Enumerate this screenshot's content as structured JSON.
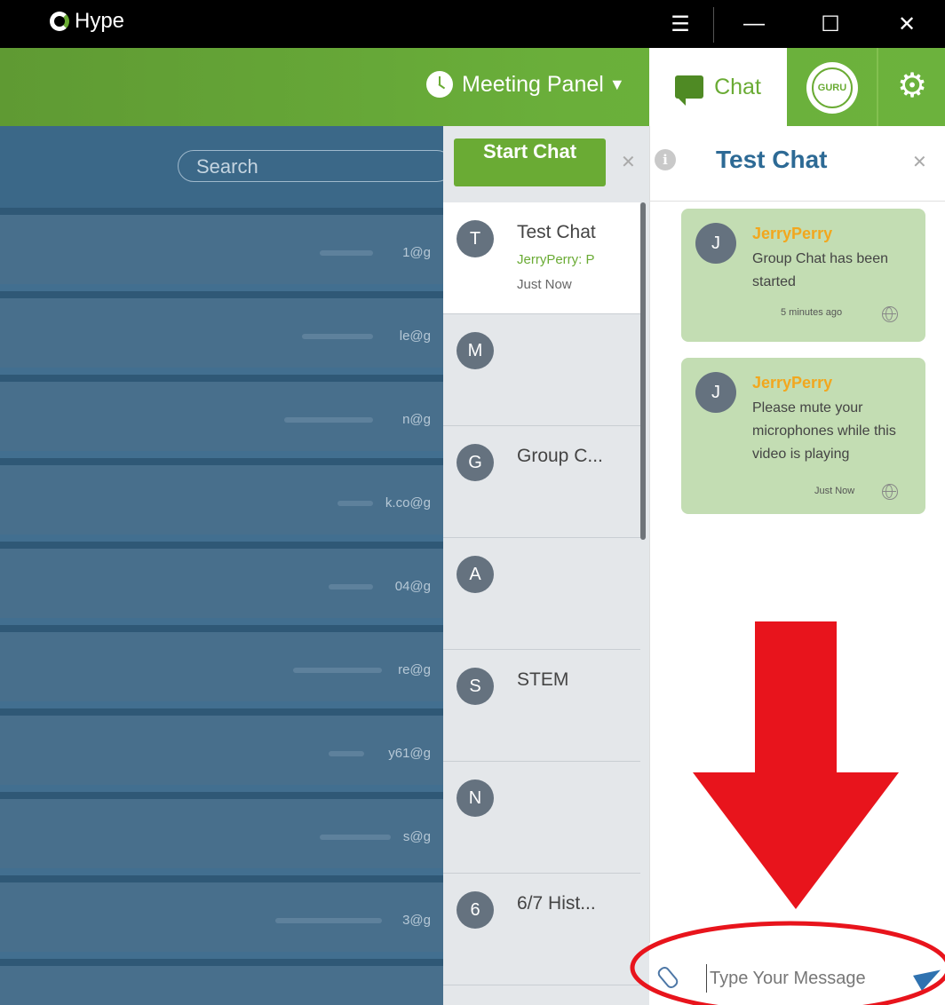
{
  "titlebar": {
    "app_name": "Hype",
    "menu_glyph": "☰",
    "minimize_glyph": "—",
    "maximize_glyph": "☐",
    "close_glyph": "✕"
  },
  "header": {
    "meeting_panel_label": "Meeting Panel",
    "meeting_panel_caret": "▼",
    "chat_tab_label": "Chat",
    "guru_label": "GURU",
    "settings_glyph": "⚙"
  },
  "contacts": {
    "search_placeholder": "Search",
    "rows": [
      {
        "email": "1@g"
      },
      {
        "email": "le@g"
      },
      {
        "email": "n@g"
      },
      {
        "email": "k.co@g"
      },
      {
        "email": "04@g"
      },
      {
        "email": "re@g"
      },
      {
        "email": "y61@g"
      },
      {
        "email": "s@g"
      },
      {
        "email": "3@g"
      },
      {
        "email": ""
      }
    ]
  },
  "chatlist": {
    "start_chat_label": "Start Chat",
    "close_glyph": "✕",
    "items": [
      {
        "initial": "T",
        "title": "Test Chat",
        "preview": "JerryPerry: P",
        "time": "Just Now",
        "active": true
      },
      {
        "initial": "M",
        "title": "",
        "preview": "",
        "time": ""
      },
      {
        "initial": "G",
        "title": "Group C...",
        "preview": "",
        "time": ""
      },
      {
        "initial": "A",
        "title": "",
        "preview": "",
        "time": ""
      },
      {
        "initial": "S",
        "title": "STEM",
        "preview": "",
        "time": ""
      },
      {
        "initial": "N",
        "title": "",
        "preview": "",
        "time": ""
      },
      {
        "initial": "6",
        "title": "6/7 Hist...",
        "preview": "",
        "time": ""
      }
    ]
  },
  "conversation": {
    "info_glyph": "i",
    "title": "Test Chat",
    "close_glyph": "✕",
    "messages": [
      {
        "initial": "J",
        "sender": "JerryPerry",
        "text": "Group Chat has been started",
        "time": "5 minutes ago"
      },
      {
        "initial": "J",
        "sender": "JerryPerry",
        "text": "Please mute your microphones while this video is playing",
        "time": "Just Now"
      }
    ],
    "input_placeholder": "Type Your Message"
  },
  "colors": {
    "brand_green": "#6aab34",
    "panel_blue": "#426f90",
    "title_blue": "#2d6a95",
    "sender_orange": "#f2a71e",
    "annotation_red": "#e8141c"
  }
}
